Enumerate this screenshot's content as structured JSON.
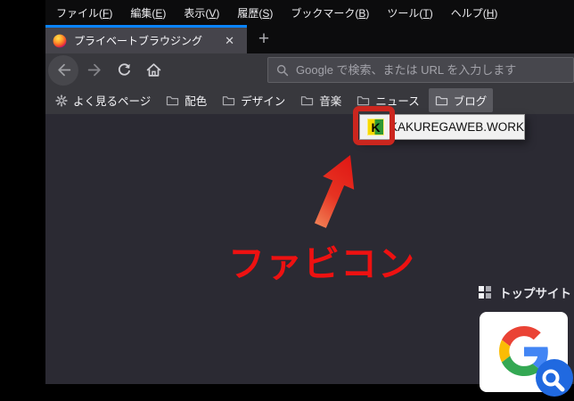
{
  "menubar": {
    "items": [
      {
        "pre": "ファイル(",
        "key": "F",
        "post": ")"
      },
      {
        "pre": "編集(",
        "key": "E",
        "post": ")"
      },
      {
        "pre": "表示(",
        "key": "V",
        "post": ")"
      },
      {
        "pre": "履歴(",
        "key": "S",
        "post": ")"
      },
      {
        "pre": "ブックマーク(",
        "key": "B",
        "post": ")"
      },
      {
        "pre": "ツール(",
        "key": "T",
        "post": ")"
      },
      {
        "pre": "ヘルプ(",
        "key": "H",
        "post": ")"
      }
    ]
  },
  "tabbar": {
    "active_tab": {
      "title": "プライベートブラウジング"
    },
    "close_glyph": "✕",
    "new_tab_glyph": "+"
  },
  "navbar": {
    "url_placeholder": "Google で検索、または URL を入力します"
  },
  "bookmarks": {
    "items": [
      {
        "icon": "gear-icon",
        "label": "よく見るページ"
      },
      {
        "icon": "folder-icon",
        "label": "配色"
      },
      {
        "icon": "folder-icon",
        "label": "デザイン"
      },
      {
        "icon": "folder-icon",
        "label": "音楽"
      },
      {
        "icon": "folder-icon",
        "label": "ニュース"
      },
      {
        "icon": "folder-icon",
        "label": "ブログ",
        "state": "open"
      }
    ]
  },
  "dropdown": {
    "items": [
      {
        "favicon_letter": "K",
        "label": "KAKUREGAWEB.WORK"
      }
    ]
  },
  "annotation": {
    "label": "ファビコン",
    "box_color": "#cb261e",
    "arrow_color_top": "#df1111",
    "arrow_color_bottom": "#f08055",
    "text_color": "#ee1111"
  },
  "topsites": {
    "title": "トップサイト"
  },
  "colors": {
    "tab_accent_blue": "#0a84ff",
    "favicon_yellow": "#f6d900",
    "favicon_green": "#2c9732",
    "google_red": "#ea4335",
    "google_blue": "#4285f4",
    "google_yellow": "#fbbc05",
    "google_green": "#34a853",
    "badge_blue": "#2069e0"
  }
}
